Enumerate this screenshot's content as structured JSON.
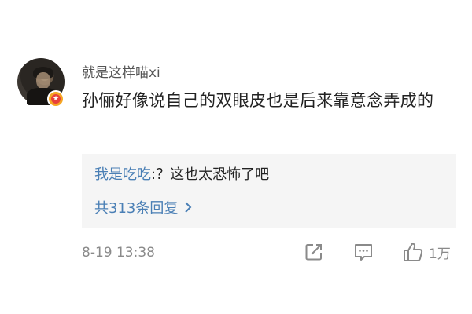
{
  "comment": {
    "username": "就是这样喵xi",
    "text": "孙俪好像说自己的双眼皮也是后来靠意念弄成的",
    "reply": {
      "author": "我是吃吃",
      "separator": ":",
      "text": "？这也太恐怖了吧",
      "more_label": "共313条回复"
    },
    "timestamp": "8-19 13:38",
    "like_count": "1万"
  },
  "colors": {
    "link": "#4a7fb5",
    "badge_outer": "#f5a623",
    "badge_inner": "#e8403a"
  },
  "icons": [
    "vip-badge-icon",
    "chevron-right-icon",
    "share-icon",
    "comment-icon",
    "thumbs-up-icon"
  ]
}
